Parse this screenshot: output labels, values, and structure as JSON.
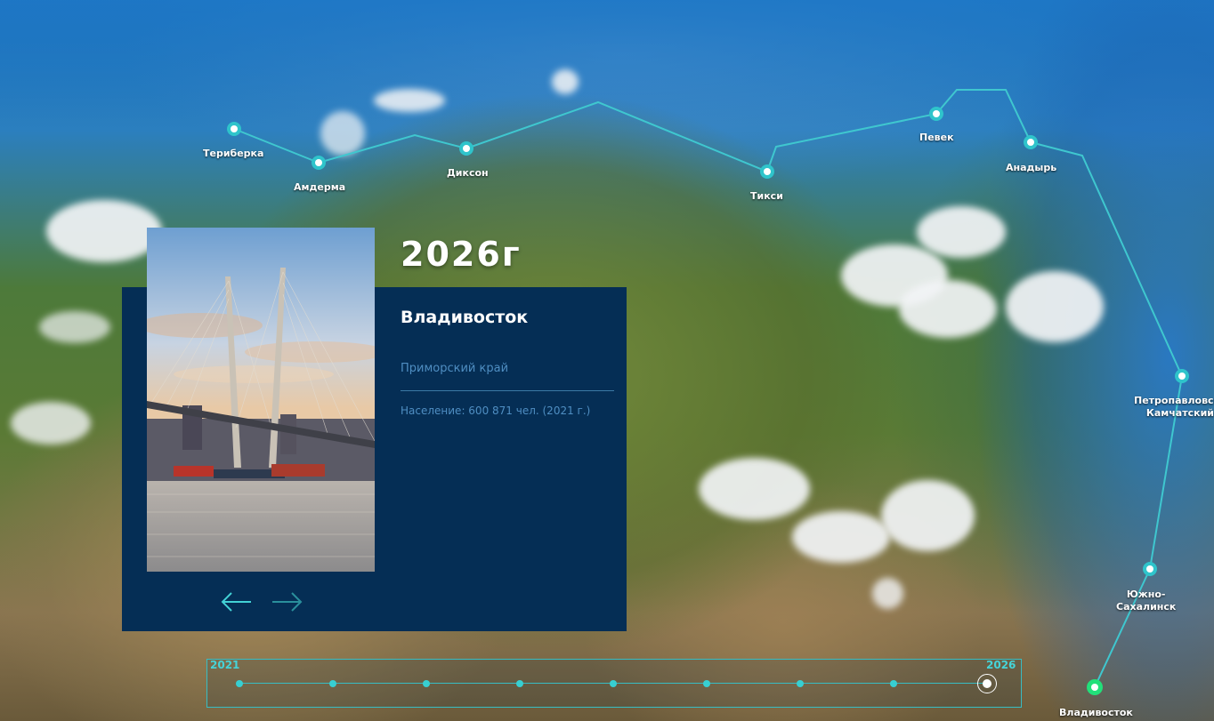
{
  "colors": {
    "card_bg": "#052e55",
    "accent": "#37cfd2",
    "route_line": "#3fc7cf",
    "muted_text": "#4f8ec2",
    "active_city": "#22e07a"
  },
  "route": {
    "cities": [
      {
        "name": "Териберка"
      },
      {
        "name": "Амдерма"
      },
      {
        "name": "Диксон"
      },
      {
        "name": "Тикси"
      },
      {
        "name": "Певек"
      },
      {
        "name": "Анадырь"
      },
      {
        "name": "Петропавловск-Камчатский",
        "line1": "Петропавловск-",
        "line2": "Камчатский"
      },
      {
        "name": "Южно-Сахалинск",
        "line1": "Южно-",
        "line2": "Сахалинск"
      },
      {
        "name": "Владивосток",
        "active": true
      }
    ]
  },
  "year_title": "2026г",
  "card": {
    "title": "Владивосток",
    "region": "Приморский край",
    "population": "Население: 600 871 чел. (2021 г.)",
    "prev_icon": "arrow-left-icon",
    "next_icon": "arrow-right-icon"
  },
  "timeline": {
    "start_label": "2021",
    "end_label": "2026",
    "steps": 9,
    "active_step": 9
  }
}
